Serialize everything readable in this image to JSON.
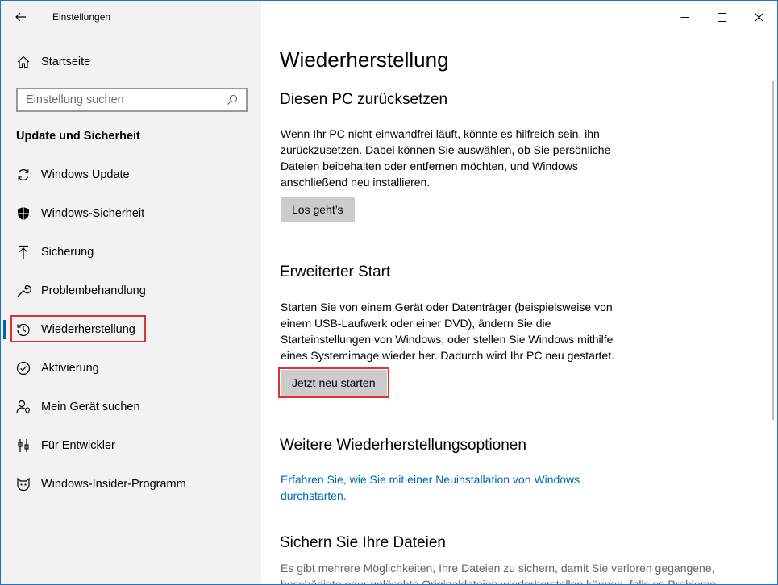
{
  "window": {
    "title": "Einstellungen",
    "controls": {
      "minimize": "minimize-icon",
      "maximize": "maximize-icon",
      "close": "close-icon"
    }
  },
  "sidebar": {
    "home_label": "Startseite",
    "search_placeholder": "Einstellung suchen",
    "section_title": "Update und Sicherheit",
    "items": [
      {
        "label": "Windows Update",
        "icon": "sync-icon"
      },
      {
        "label": "Windows-Sicherheit",
        "icon": "shield-icon"
      },
      {
        "label": "Sicherung",
        "icon": "backup-arrow-icon"
      },
      {
        "label": "Problembehandlung",
        "icon": "wrench-icon"
      },
      {
        "label": "Wiederherstellung",
        "icon": "history-icon",
        "active": true
      },
      {
        "label": "Aktivierung",
        "icon": "check-circle-icon"
      },
      {
        "label": "Mein Gerät suchen",
        "icon": "person-location-icon"
      },
      {
        "label": "Für Entwickler",
        "icon": "developer-icon"
      },
      {
        "label": "Windows-Insider-Programm",
        "icon": "insider-cat-icon"
      }
    ]
  },
  "main": {
    "title": "Wiederherstellung",
    "reset": {
      "heading": "Diesen PC zurücksetzen",
      "text": "Wenn Ihr PC nicht einwandfrei läuft, könnte es hilfreich sein, ihn zurückzusetzen. Dabei können Sie auswählen, ob Sie persönliche Dateien beibehalten oder entfernen möchten, und Windows anschließend neu installieren.",
      "button": "Los geht’s"
    },
    "advanced": {
      "heading": "Erweiterter Start",
      "text": "Starten Sie von einem Gerät oder Datenträger (beispielsweise von einem USB-Laufwerk oder einer DVD), ändern Sie die Starteinstellungen von Windows, oder stellen Sie Windows mithilfe eines Systemimage wieder her. Dadurch wird Ihr PC neu gestartet.",
      "button": "Jetzt neu starten"
    },
    "more": {
      "heading": "Weitere Wiederherstellungsoptionen",
      "link": "Erfahren Sie, wie Sie mit einer Neuinstallation von Windows durchstarten."
    },
    "backup": {
      "heading": "Sichern Sie Ihre Dateien",
      "line1": "Es gibt mehrere Möglichkeiten, Ihre Dateien zu sichern, damit Sie verloren gegangene,",
      "line2": "beschädigte oder gelöschte Originaldateien wiederherstellen können, falls es Probleme"
    }
  },
  "colors": {
    "accent": "#0063b1",
    "highlight": "#e0312f",
    "link": "#0067b8",
    "sidebar_bg": "#f2f2f2",
    "button_bg": "#cccccc"
  }
}
